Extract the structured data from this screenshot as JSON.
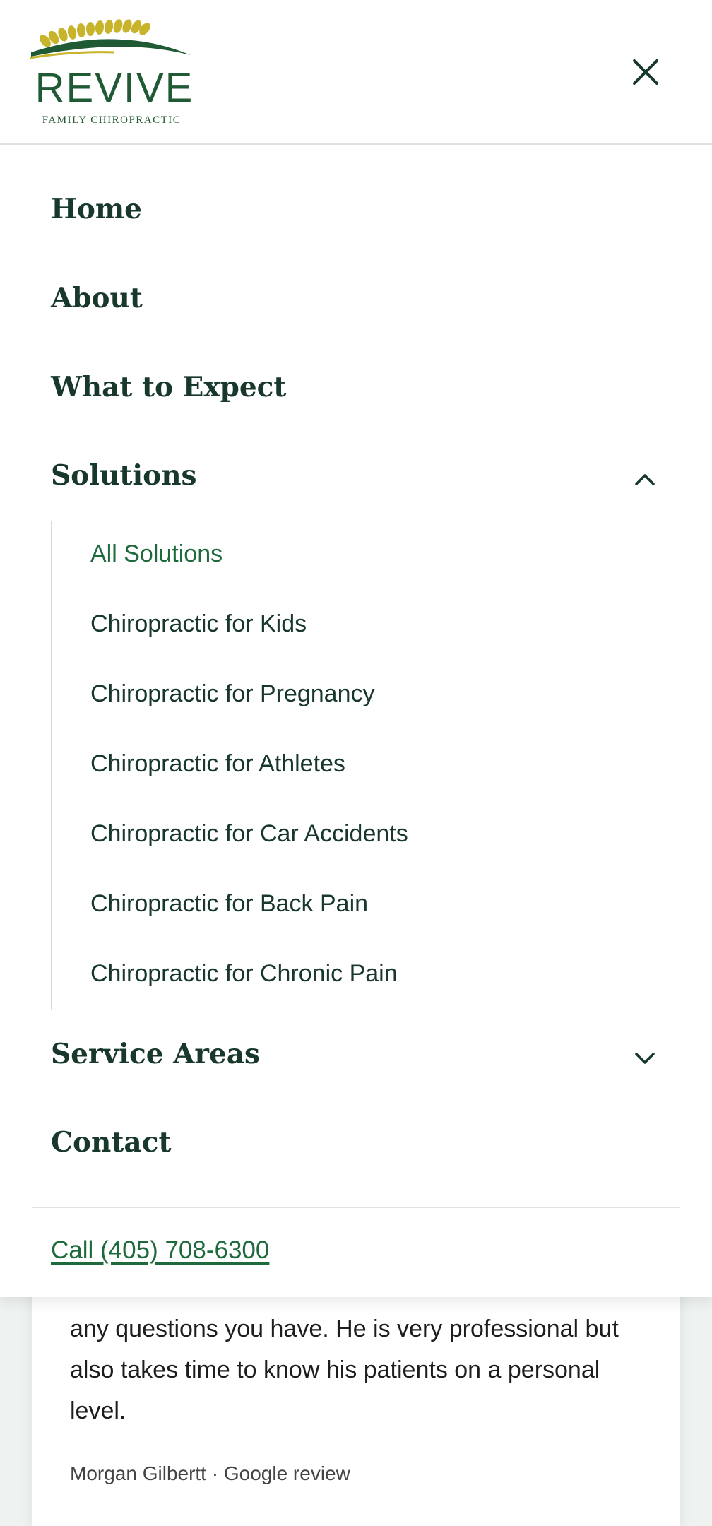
{
  "logo": {
    "brand": "REVIVE",
    "tagline": "FAMILY CHIROPRACTIC",
    "colors": {
      "green": "#1f5a34",
      "gold": "#c8b42a"
    }
  },
  "header": {
    "close_icon": "close-icon"
  },
  "menu": {
    "items": [
      {
        "label": "Home"
      },
      {
        "label": "About"
      },
      {
        "label": "What to Expect"
      },
      {
        "label": "Solutions",
        "expanded": true,
        "chevron": "chevron-up-icon"
      },
      {
        "label": "Service Areas",
        "expanded": false,
        "chevron": "chevron-down-icon"
      },
      {
        "label": "Contact"
      }
    ],
    "solutions_sub": [
      {
        "label": "All Solutions",
        "active": true
      },
      {
        "label": "Chiropractic for Kids"
      },
      {
        "label": "Chiropractic for Pregnancy"
      },
      {
        "label": "Chiropractic for Athletes"
      },
      {
        "label": "Chiropractic for Car Accidents"
      },
      {
        "label": "Chiropractic for Back Pain"
      },
      {
        "label": "Chiropractic for Chronic Pain"
      }
    ],
    "call_label": "Call (405) 708-6300"
  },
  "review": {
    "text": "any questions you have. He is very professional but also takes time to know his patients on a personal level.",
    "author": "Morgan Gilbertt · Google review"
  },
  "colors": {
    "primary_text": "#17382a",
    "accent_green": "#1f6a3c",
    "background": "#eef2f1"
  }
}
